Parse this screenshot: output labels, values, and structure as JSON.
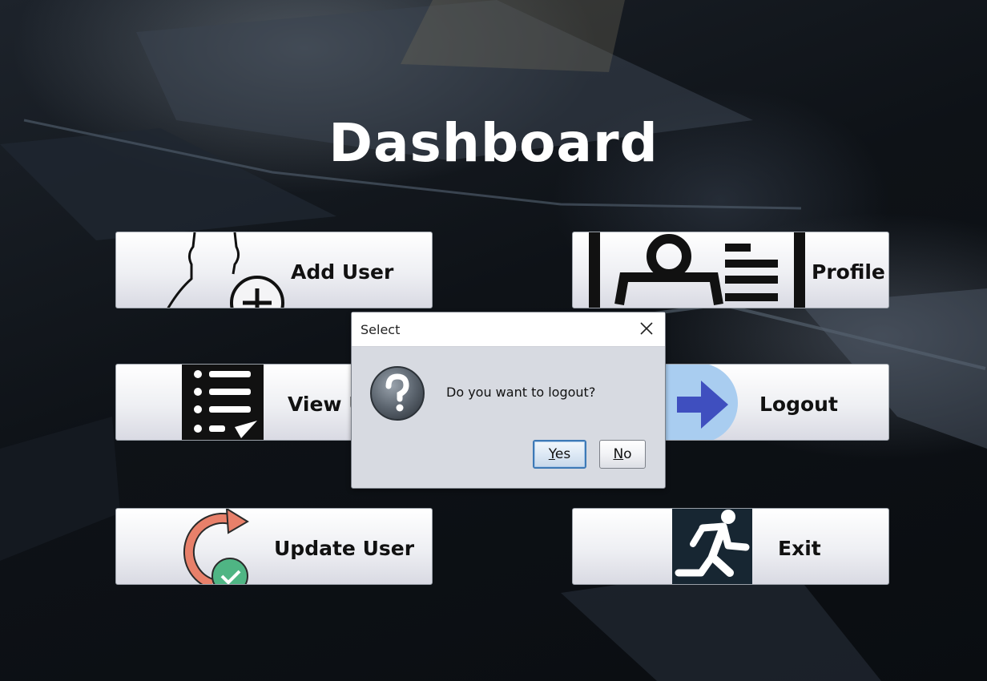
{
  "page": {
    "title": "Dashboard"
  },
  "tiles": {
    "add_user": {
      "label": "Add User",
      "icon": "add-user-icon"
    },
    "profile": {
      "label": "Profile",
      "icon": "profile-card-icon"
    },
    "view_users": {
      "label": "View U",
      "icon": "list-icon"
    },
    "logout": {
      "label": "Logout",
      "icon": "arrow-right-icon"
    },
    "update_user": {
      "label": "Update User",
      "icon": "refresh-check-icon"
    },
    "exit": {
      "label": "Exit",
      "icon": "running-man-icon"
    }
  },
  "dialog": {
    "title": "Select",
    "message": "Do you want to logout?",
    "icon": "question-icon",
    "yes_mnemonic": "Y",
    "yes_rest": "es",
    "no_mnemonic": "N",
    "no_rest": "o"
  },
  "colors": {
    "logout_arrow": "#3f4fbf",
    "logout_circle": "#a9cdf0",
    "update_arrow": "#e8806a",
    "update_check": "#4fb584",
    "exit_bg": "#172632"
  }
}
